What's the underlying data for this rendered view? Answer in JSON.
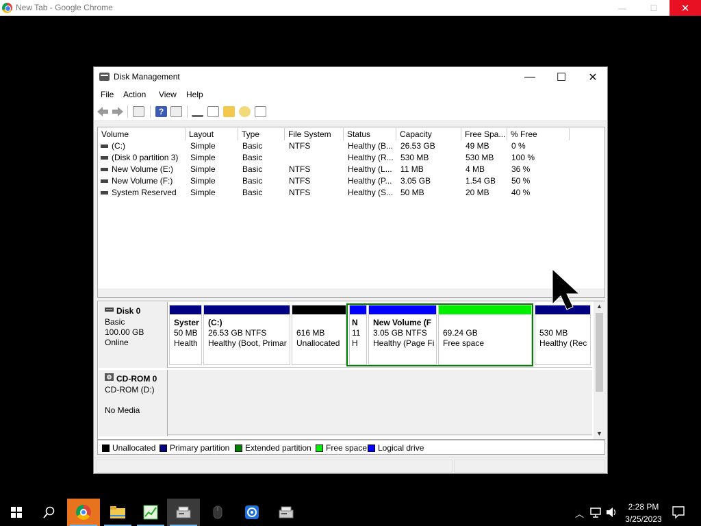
{
  "chrome": {
    "title": "New Tab - Google Chrome",
    "minimize": "—",
    "maximize": "☐",
    "close": "✕"
  },
  "window": {
    "title": "Disk Management",
    "minimize": "—",
    "maximize": "☐",
    "close": "✕"
  },
  "menu": [
    "File",
    "Action",
    "View",
    "Help"
  ],
  "columns": [
    "Volume",
    "Layout",
    "Type",
    "File System",
    "Status",
    "Capacity",
    "Free Spa...",
    "% Free"
  ],
  "volumes": [
    {
      "volume": "(C:)",
      "layout": "Simple",
      "type": "Basic",
      "fs": "NTFS",
      "status": "Healthy (B...",
      "capacity": "26.53 GB",
      "free": "49 MB",
      "pct": "0 %"
    },
    {
      "volume": "(Disk 0 partition 3)",
      "layout": "Simple",
      "type": "Basic",
      "fs": "",
      "status": "Healthy (R...",
      "capacity": "530 MB",
      "free": "530 MB",
      "pct": "100 %"
    },
    {
      "volume": "New Volume (E:)",
      "layout": "Simple",
      "type": "Basic",
      "fs": "NTFS",
      "status": "Healthy (L...",
      "capacity": "11 MB",
      "free": "4 MB",
      "pct": "36 %"
    },
    {
      "volume": "New Volume (F:)",
      "layout": "Simple",
      "type": "Basic",
      "fs": "NTFS",
      "status": "Healthy (P...",
      "capacity": "3.05 GB",
      "free": "1.54 GB",
      "pct": "50 %"
    },
    {
      "volume": "System Reserved",
      "layout": "Simple",
      "type": "Basic",
      "fs": "NTFS",
      "status": "Healthy (S...",
      "capacity": "50 MB",
      "free": "20 MB",
      "pct": "40 %"
    }
  ],
  "disk0": {
    "name": "Disk 0",
    "type": "Basic",
    "size": "100.00 GB",
    "state": "Online",
    "partitions": [
      {
        "l1": "Syster",
        "l2": "50 MB",
        "l3": "Health",
        "color": "#000080"
      },
      {
        "l1": "(C:)",
        "l2": "26.53 GB NTFS",
        "l3": "Healthy (Boot, Primar",
        "color": "#000080"
      },
      {
        "l1": "",
        "l2": "616 MB",
        "l3": "Unallocated",
        "color": "#000000"
      },
      {
        "l1": "N",
        "l2": "11",
        "l3": "H",
        "color": "#0000ff"
      },
      {
        "l1": "New Volume  (F",
        "l2": "3.05 GB NTFS",
        "l3": "Healthy (Page Fi",
        "color": "#0000ff"
      },
      {
        "l1": "",
        "l2": "69.24 GB",
        "l3": "Free space",
        "color": "#00ee00"
      },
      {
        "l1": "",
        "l2": "530 MB",
        "l3": "Healthy (Rec",
        "color": "#000080"
      }
    ]
  },
  "cdrom": {
    "name": "CD-ROM 0",
    "drive": "CD-ROM (D:)",
    "media": "No Media"
  },
  "legend": [
    {
      "label": "Unallocated",
      "color": "#000000"
    },
    {
      "label": "Primary partition",
      "color": "#000080"
    },
    {
      "label": "Extended partition",
      "color": "#008000"
    },
    {
      "label": "Free space",
      "color": "#00ee00"
    },
    {
      "label": "Logical drive",
      "color": "#0000ff"
    }
  ],
  "taskbar": {
    "time": "2:28 PM",
    "date": "3/25/2023"
  }
}
